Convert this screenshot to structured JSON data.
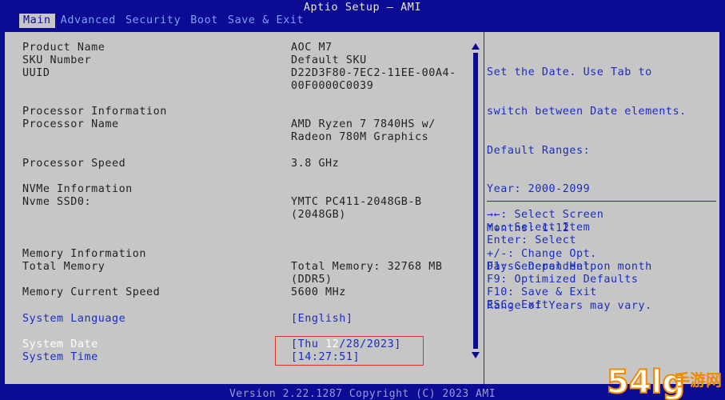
{
  "window": {
    "title": "Aptio Setup – AMI"
  },
  "menu": [
    {
      "label": "Main",
      "active": true
    },
    {
      "label": "Advanced",
      "active": false
    },
    {
      "label": "Security",
      "active": false
    },
    {
      "label": "Boot",
      "active": false
    },
    {
      "label": "Save & Exit",
      "active": false
    }
  ],
  "info": {
    "product_name": {
      "label": "Product Name",
      "value": "AOC M7"
    },
    "sku_number": {
      "label": "SKU Number",
      "value": "Default SKU"
    },
    "uuid": {
      "label": "UUID",
      "value_line1": "D22D3F80-7EC2-11EE-00A4-",
      "value_line2": "00F0000C0039"
    },
    "processor_heading": "Processor Information",
    "processor_name": {
      "label": "Processor Name",
      "value_line1": "AMD Ryzen 7 7840HS w/",
      "value_line2": "Radeon 780M Graphics"
    },
    "processor_speed": {
      "label": "Processor Speed",
      "value": "3.8 GHz"
    },
    "nvme_heading": "NVMe Information",
    "nvme_ssd": {
      "label": "Nvme SSD0:",
      "value_line1": "YMTC PC411-2048GB-B",
      "value_line2": "(2048GB)"
    },
    "memory_heading": "Memory Information",
    "total_memory": {
      "label": "Total Memory",
      "value_line1": "Total Memory: 32768 MB",
      "value_line2": "(DDR5)"
    },
    "memory_speed": {
      "label": "Memory Current Speed",
      "value": "5600 MHz"
    },
    "system_language": {
      "label": "System Language",
      "value": "[English]"
    },
    "system_date": {
      "label": "System Date",
      "value_pre": "[Thu ",
      "value_hl": "12",
      "value_post": "/28/2023]"
    },
    "system_time": {
      "label": "System Time",
      "value": "[14:27:51]"
    }
  },
  "help": {
    "lines": [
      "Set the Date. Use Tab to",
      "switch between Date elements.",
      "Default Ranges:",
      "Year: 2000-2099",
      "Months: 1-12",
      "Days: Dependent on month",
      "Range of Years may vary."
    ]
  },
  "keys": [
    "→←: Select Screen",
    "↑↓: Select Item",
    "Enter: Select",
    "+/-: Change Opt.",
    "F1: General Help",
    "F9: Optimized Defaults",
    "F10: Save & Exit",
    "ESC: Exit"
  ],
  "footer": "Version 2.22.1287 Copyright (C) 2023 AMI",
  "watermark": {
    "text": "54lg",
    "subtext": "手游网"
  },
  "colors": {
    "background": "#0b0b93",
    "panel": "#c6c6c6",
    "accent": "#1a2cc0",
    "selection_box": "#e0301e"
  }
}
